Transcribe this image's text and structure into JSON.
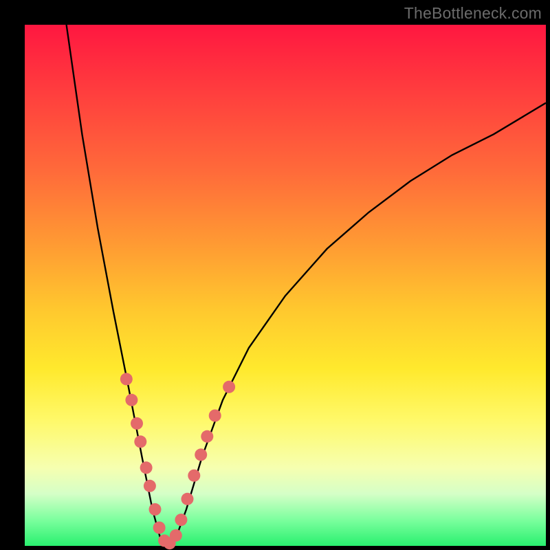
{
  "watermark": "TheBottleneck.com",
  "chart_data": {
    "type": "line",
    "title": "",
    "xlabel": "",
    "ylabel": "",
    "xlim": [
      0,
      1
    ],
    "ylim": [
      0,
      1
    ],
    "note": "Axes are unlabeled; x/y are normalized 0–1 over the plot area. y=0 is the bottom (green). Curve is a sharp V dipping to ~0 near x≈0.27, left arm reaching y≈1 at x≈0.08, right arm rising asymptotically to y≈0.85 at x=1.",
    "series": [
      {
        "name": "curve",
        "x": [
          0.08,
          0.11,
          0.14,
          0.17,
          0.2,
          0.225,
          0.245,
          0.26,
          0.275,
          0.29,
          0.31,
          0.34,
          0.38,
          0.43,
          0.5,
          0.58,
          0.66,
          0.74,
          0.82,
          0.9,
          1.0
        ],
        "y": [
          1.0,
          0.79,
          0.61,
          0.45,
          0.3,
          0.17,
          0.07,
          0.015,
          0.0,
          0.015,
          0.07,
          0.17,
          0.28,
          0.38,
          0.48,
          0.57,
          0.64,
          0.7,
          0.75,
          0.79,
          0.85
        ]
      }
    ],
    "markers": {
      "name": "highlight-dots",
      "color": "#e46a6a",
      "points": [
        {
          "x": 0.195,
          "y": 0.32
        },
        {
          "x": 0.205,
          "y": 0.28
        },
        {
          "x": 0.215,
          "y": 0.235
        },
        {
          "x": 0.222,
          "y": 0.2
        },
        {
          "x": 0.233,
          "y": 0.15
        },
        {
          "x": 0.24,
          "y": 0.115
        },
        {
          "x": 0.25,
          "y": 0.07
        },
        {
          "x": 0.258,
          "y": 0.035
        },
        {
          "x": 0.268,
          "y": 0.01
        },
        {
          "x": 0.278,
          "y": 0.005
        },
        {
          "x": 0.29,
          "y": 0.02
        },
        {
          "x": 0.3,
          "y": 0.05
        },
        {
          "x": 0.312,
          "y": 0.09
        },
        {
          "x": 0.325,
          "y": 0.135
        },
        {
          "x": 0.338,
          "y": 0.175
        },
        {
          "x": 0.35,
          "y": 0.21
        },
        {
          "x": 0.365,
          "y": 0.25
        },
        {
          "x": 0.392,
          "y": 0.305
        }
      ]
    }
  }
}
